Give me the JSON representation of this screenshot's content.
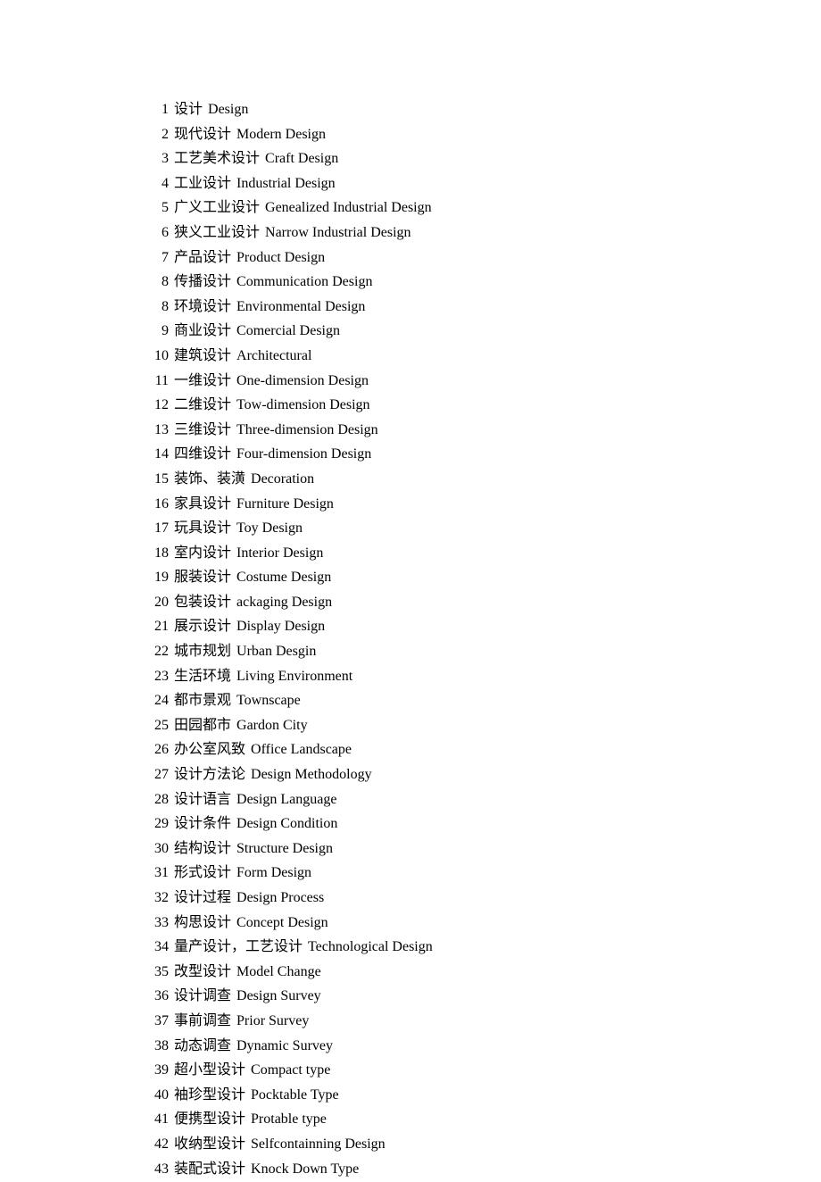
{
  "entries": [
    {
      "num": "1",
      "cn": "设计",
      "en": "Design"
    },
    {
      "num": "2",
      "cn": "现代设计",
      "en": "Modern Design"
    },
    {
      "num": "3",
      "cn": "工艺美术设计",
      "en": "Craft Design"
    },
    {
      "num": "4",
      "cn": "工业设计",
      "en": "Industrial Design"
    },
    {
      "num": "5",
      "cn": "广义工业设计",
      "en": "Genealized Industrial Design"
    },
    {
      "num": "6",
      "cn": "狭义工业设计",
      "en": "Narrow Industrial Design"
    },
    {
      "num": "7",
      "cn": "产品设计",
      "en": "Product Design"
    },
    {
      "num": "8",
      "cn": "传播设计",
      "en": "Communication Design"
    },
    {
      "num": "8",
      "cn": "环境设计",
      "en": "Environmental Design"
    },
    {
      "num": "9",
      "cn": "商业设计",
      "en": "Comercial Design"
    },
    {
      "num": "10",
      "cn": "建筑设计",
      "en": "Architectural"
    },
    {
      "num": "11",
      "cn": "一维设计",
      "en": "One-dimension Design"
    },
    {
      "num": "12",
      "cn": "二维设计",
      "en": "Tow-dimension Design"
    },
    {
      "num": "13",
      "cn": "三维设计",
      "en": "Three-dimension Design"
    },
    {
      "num": "14",
      "cn": "四维设计",
      "en": "Four-dimension Design"
    },
    {
      "num": "15",
      "cn": "装饰、装潢",
      "en": "Decoration"
    },
    {
      "num": "16",
      "cn": "家具设计",
      "en": "Furniture Design"
    },
    {
      "num": "17",
      "cn": "玩具设计",
      "en": "Toy Design"
    },
    {
      "num": "18",
      "cn": "室内设计",
      "en": "Interior Design"
    },
    {
      "num": "19",
      "cn": "服装设计",
      "en": "Costume Design"
    },
    {
      "num": "20",
      "cn": "包装设计",
      "en": "ackaging Design"
    },
    {
      "num": "21",
      "cn": "展示设计",
      "en": "Display Design"
    },
    {
      "num": "22",
      "cn": "城市规划",
      "en": "Urban Desgin"
    },
    {
      "num": "23",
      "cn": "生活环境",
      "en": "Living Environment"
    },
    {
      "num": "24",
      "cn": "都市景观",
      "en": "Townscape"
    },
    {
      "num": "25",
      "cn": "田园都市",
      "en": "Gardon City"
    },
    {
      "num": "26",
      "cn": "办公室风致",
      "en": "Office Landscape"
    },
    {
      "num": "27",
      "cn": "设计方法论",
      "en": "Design Methodology"
    },
    {
      "num": "28",
      "cn": "设计语言",
      "en": "Design Language"
    },
    {
      "num": "29",
      "cn": "设计条件",
      "en": "Design Condition"
    },
    {
      "num": "30",
      "cn": "结构设计",
      "en": "Structure Design"
    },
    {
      "num": "31",
      "cn": "形式设计",
      "en": "Form Design"
    },
    {
      "num": "32",
      "cn": "设计过程",
      "en": "Design Process"
    },
    {
      "num": "33",
      "cn": "构思设计",
      "en": "Concept Design"
    },
    {
      "num": "34",
      "cn": "量产设计，工艺设计",
      "en": "Technological Design"
    },
    {
      "num": "35",
      "cn": "改型设计",
      "en": "Model Change"
    },
    {
      "num": "36",
      "cn": "设计调查",
      "en": "Design Survey"
    },
    {
      "num": "37",
      "cn": "事前调查",
      "en": "Prior Survey"
    },
    {
      "num": "38",
      "cn": "动态调查",
      "en": "Dynamic Survey"
    },
    {
      "num": "39",
      "cn": "超小型设计",
      "en": "Compact type"
    },
    {
      "num": "40",
      "cn": "袖珍型设计",
      "en": "Pocktable Type"
    },
    {
      "num": "41",
      "cn": "便携型设计",
      "en": "Protable type"
    },
    {
      "num": "42",
      "cn": "收纳型设计",
      "en": "Selfcontainning Design"
    },
    {
      "num": "43",
      "cn": "装配式设计",
      "en": "Knock Down Type"
    }
  ]
}
